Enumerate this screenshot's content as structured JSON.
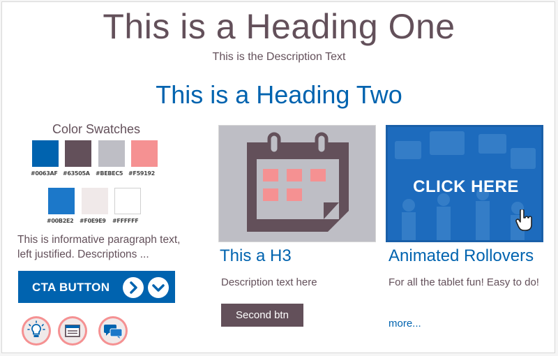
{
  "header": {
    "heading_one": "This is a Heading One",
    "description": "This is the Description Text",
    "heading_two": "This is a Heading Two"
  },
  "swatches": {
    "title": "Color Swatches",
    "items": [
      {
        "color": "#0063AF",
        "label": "#0063AF"
      },
      {
        "color": "#63505A",
        "label": "#63505A"
      },
      {
        "color": "#BEBEC5",
        "label": "#BEBEC5"
      },
      {
        "color": "#F59192",
        "label": "#F59192"
      },
      {
        "color": "#00B2E2",
        "label": "#00B2E2"
      },
      {
        "color": "#F0E9E9",
        "label": "#F0E9E9"
      },
      {
        "color": "#FFFFFF",
        "label": "#FFFFFF"
      }
    ]
  },
  "paragraph": "This is informative paragraph text, left justified. Descriptions ...",
  "cta": {
    "label": "CTA BUTTON",
    "icons": [
      "chevron-right-icon",
      "chevron-down-icon"
    ]
  },
  "round_icons": [
    "lightbulb-icon",
    "browser-window-icon",
    "chat-bubbles-icon"
  ],
  "card_calendar": {
    "title": "This a H3",
    "description": "Description text here",
    "button_label": "Second btn",
    "icon": "calendar-icon"
  },
  "card_rollover": {
    "overlay_text": "CLICK HERE",
    "title": "Animated Rollovers",
    "description": "For all the tablet fun! Easy to do!",
    "link_label": "more...",
    "icon": "hand-pointer-icon"
  },
  "colors": {
    "primary": "#0063AF",
    "secondary": "#63505A",
    "gray": "#BEBEC5",
    "accent": "#F59192"
  }
}
